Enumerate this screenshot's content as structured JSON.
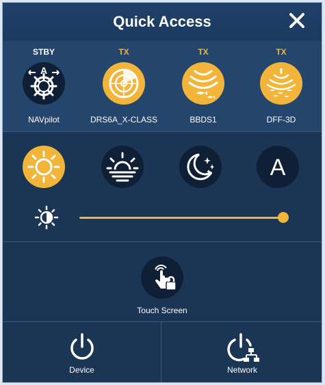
{
  "header": {
    "title": "Quick Access"
  },
  "devices": [
    {
      "status": "STBY",
      "status_color": "#ffffff",
      "label": "NAVpilot",
      "icon": "autopilot-helm-icon",
      "active": false
    },
    {
      "status": "TX",
      "status_color": "#f2b53a",
      "label": "DRS6A_X-CLASS",
      "icon": "radar-icon",
      "active": true
    },
    {
      "status": "TX",
      "status_color": "#f2b53a",
      "label": "BBDS1",
      "icon": "sonar-fish-icon",
      "active": true
    },
    {
      "status": "TX",
      "status_color": "#f2b53a",
      "label": "DFF-3D",
      "icon": "3d-sonar-icon",
      "active": true
    }
  ],
  "modes": [
    {
      "icon": "sun-icon",
      "active": true
    },
    {
      "icon": "sunset-icon",
      "active": false
    },
    {
      "icon": "moon-stars-icon",
      "active": false
    },
    {
      "icon": "auto-brightness-icon",
      "label": "A",
      "active": false
    }
  ],
  "brightness": {
    "icon": "brightness-icon",
    "level": 1.0
  },
  "touch": {
    "label": "Touch Screen",
    "icon": "touch-lock-icon"
  },
  "footer": {
    "device_label": "Device",
    "network_label": "Network"
  },
  "colors": {
    "accent": "#f2b53a",
    "panel": "#1b3554",
    "header": "#20406a",
    "device_row": "#24466d",
    "icon_dark": "#0f1f35"
  }
}
